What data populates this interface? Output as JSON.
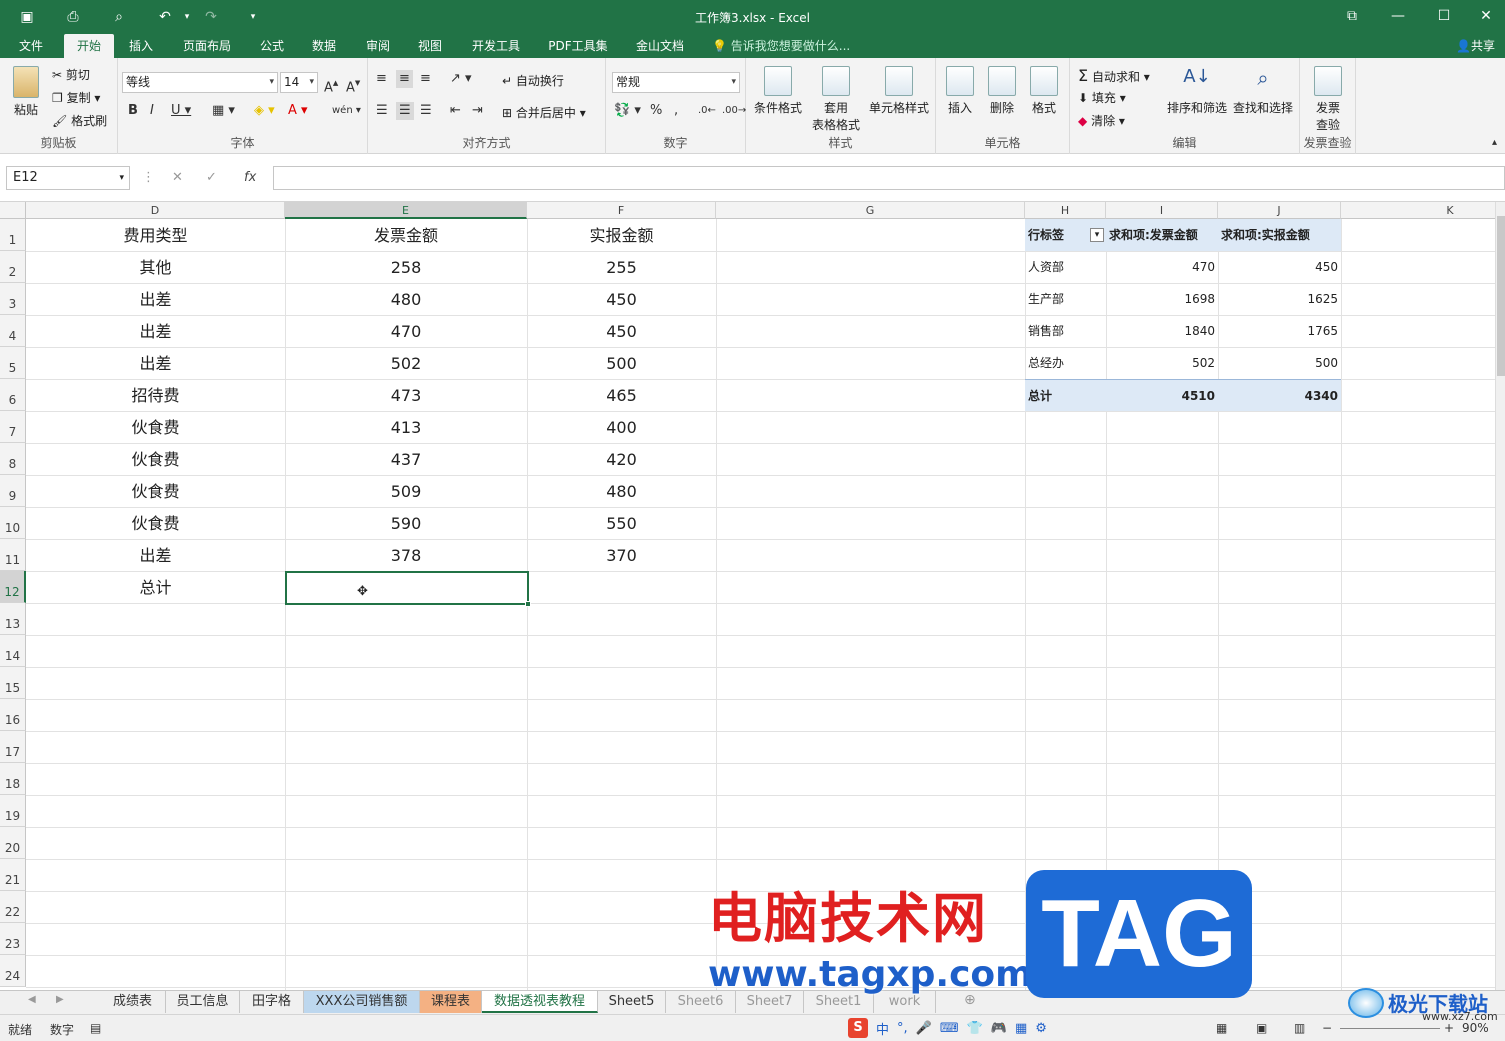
{
  "title_bar": {
    "title": "工作簿3.xlsx - Excel"
  },
  "ribbon_tabs": [
    "文件",
    "开始",
    "插入",
    "页面布局",
    "公式",
    "数据",
    "审阅",
    "视图",
    "开发工具",
    "PDF工具集",
    "金山文档"
  ],
  "active_tab": "开始",
  "tell_me": "告诉我您想要做什么...",
  "share_label": "共享",
  "ribbon": {
    "clipboard": {
      "label": "剪贴板",
      "paste": "粘贴",
      "cut": "剪切",
      "copy": "复制",
      "format_painter": "格式刷"
    },
    "font": {
      "label": "字体",
      "font_name": "等线",
      "font_size": "14"
    },
    "alignment": {
      "label": "对齐方式",
      "wrap_text": "自动换行",
      "merge_center": "合并后居中"
    },
    "number": {
      "label": "数字",
      "format": "常规"
    },
    "styles": {
      "label": "样式",
      "conditional": "条件格式",
      "table_format_1": "套用",
      "table_format_2": "表格格式",
      "cell_styles": "单元格样式"
    },
    "cells": {
      "label": "单元格",
      "insert": "插入",
      "delete": "删除",
      "format": "格式"
    },
    "editing": {
      "label": "编辑",
      "autosum": "自动求和",
      "fill": "填充",
      "clear": "清除",
      "sort_filter": "排序和筛选",
      "find_select": "查找和选择"
    },
    "invoice": {
      "label": "发票查验",
      "check_1": "发票",
      "check_2": "查验"
    }
  },
  "formula_bar": {
    "name_box": "E12",
    "formula": ""
  },
  "columns": [
    "D",
    "E",
    "F",
    "G",
    "H",
    "I",
    "J",
    "K"
  ],
  "rows": [
    "1",
    "2",
    "3",
    "4",
    "5",
    "6",
    "7",
    "8",
    "9",
    "10",
    "11",
    "12",
    "13",
    "14",
    "15",
    "16",
    "17",
    "18",
    "19",
    "20",
    "21",
    "22",
    "23",
    "24"
  ],
  "table": {
    "headers": [
      "费用类型",
      "发票金额",
      "实报金额"
    ],
    "rows": [
      [
        "其他",
        "258",
        "255"
      ],
      [
        "出差",
        "480",
        "450"
      ],
      [
        "出差",
        "470",
        "450"
      ],
      [
        "出差",
        "502",
        "500"
      ],
      [
        "招待费",
        "473",
        "465"
      ],
      [
        "伙食费",
        "413",
        "400"
      ],
      [
        "伙食费",
        "437",
        "420"
      ],
      [
        "伙食费",
        "509",
        "480"
      ],
      [
        "伙食费",
        "590",
        "550"
      ],
      [
        "出差",
        "378",
        "370"
      ]
    ],
    "total_label": "总计"
  },
  "pivot": {
    "headers": [
      "行标签",
      "求和项:发票金额",
      "求和项:实报金额"
    ],
    "rows": [
      [
        "人资部",
        "470",
        "450"
      ],
      [
        "生产部",
        "1698",
        "1625"
      ],
      [
        "销售部",
        "1840",
        "1765"
      ],
      [
        "总经办",
        "502",
        "500"
      ]
    ],
    "total": [
      "总计",
      "4510",
      "4340"
    ],
    "header_color": "#dde9f6"
  },
  "sheet_tabs": [
    "成绩表",
    "员工信息",
    "田字格",
    "XXX公司销售额",
    "课程表",
    "数据透视表教程",
    "Sheet5",
    "Sheet6",
    "Sheet7",
    "Sheet1",
    "work"
  ],
  "active_sheet": "数据透视表教程",
  "status": {
    "ready": "就绪",
    "mode": "数字",
    "zoom": "90%"
  },
  "ime": [
    "中",
    "°,"
  ],
  "watermark": {
    "cn": "电脑技术网",
    "url": "www.tagxp.com",
    "tag": "TAG",
    "site": "极光下载站",
    "site_url": "www.xz7.com"
  },
  "colors": {
    "excel_green": "#217346",
    "selection": "#217346"
  }
}
